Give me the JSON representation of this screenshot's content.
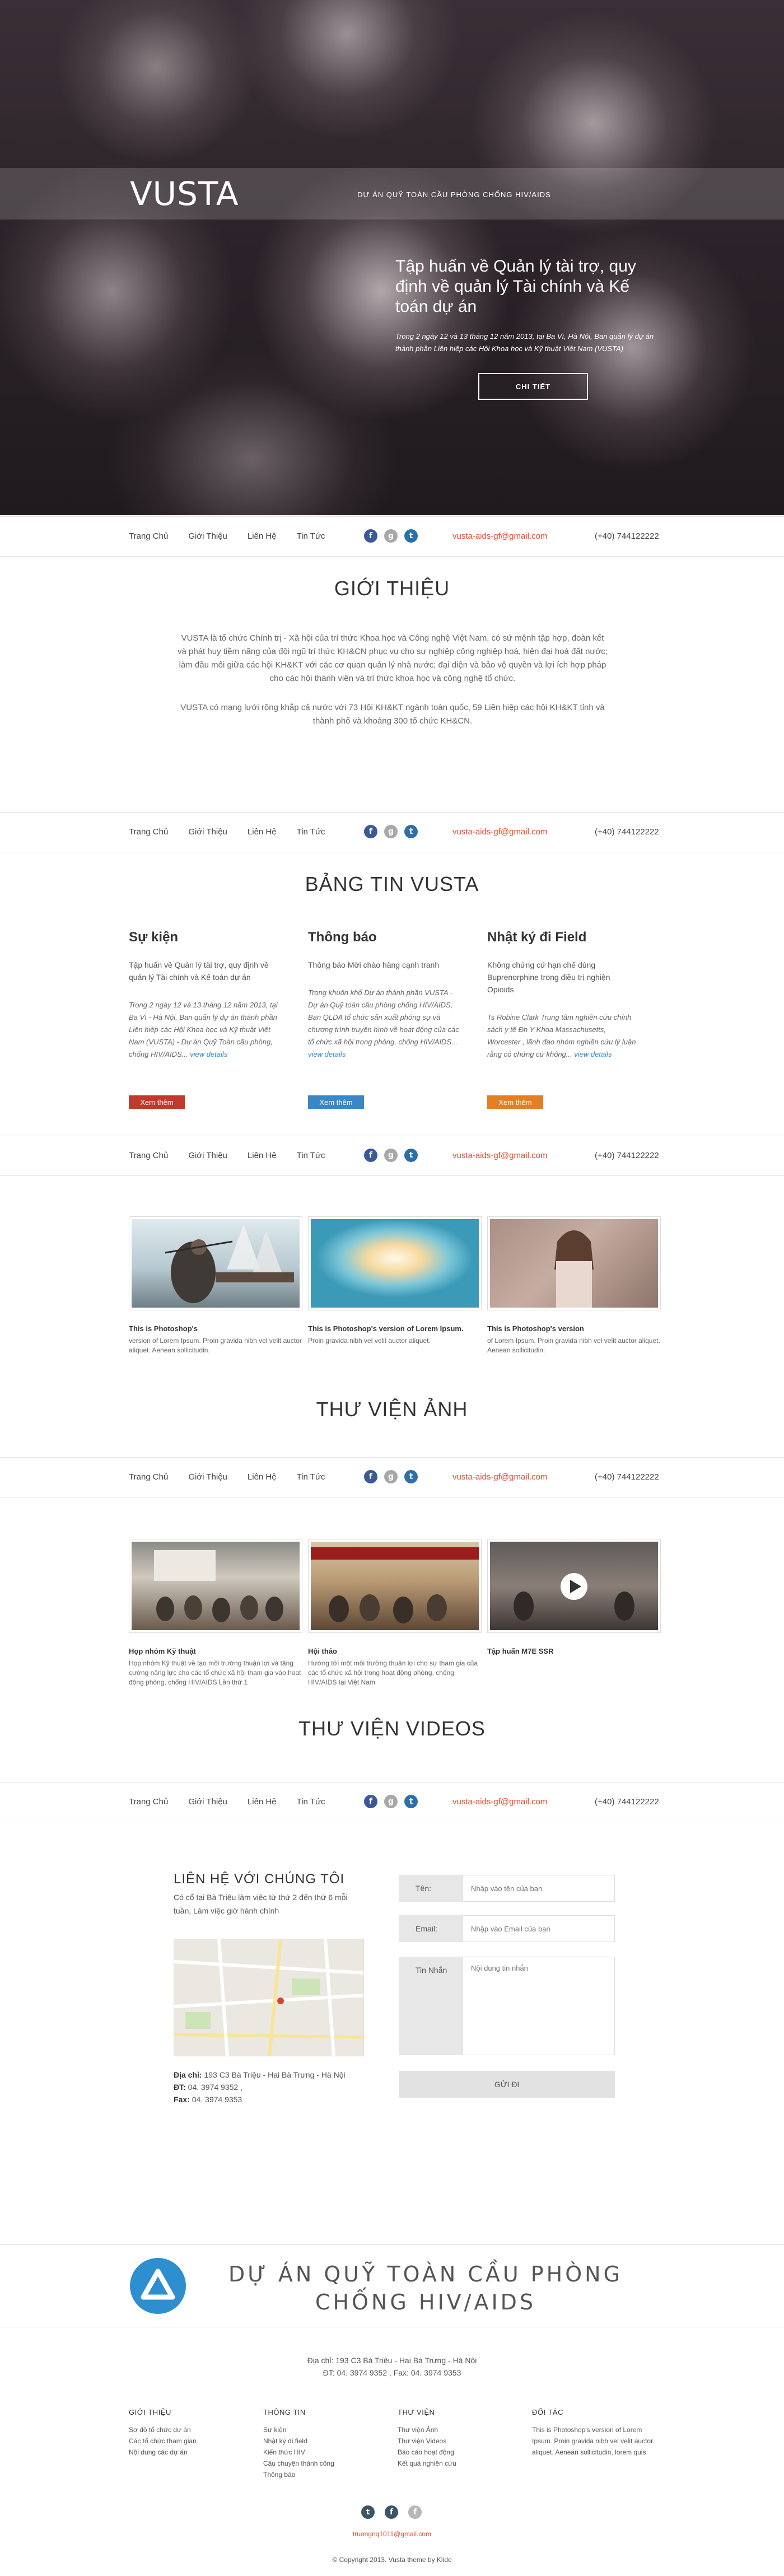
{
  "hero": {
    "logo": "VUSTA",
    "tagline": "DỰ ÁN QUỸ TOÀN CẦU PHÒNG CHỐNG HIV/AIDS",
    "heading": "Tập huấn về Quản lý tài trợ, quy định về quản lý Tài chính và Kế toán dự án",
    "subtitle": "Trong 2 ngày 12 và 13 tháng 12 năm 2013, tại Ba Vì, Hà Nội, Ban quản lý dự án thành phần Liên hiệp các Hội Khoa học và Kỹ thuật Việt Nam (VUSTA)",
    "button": "CHI TIẾT"
  },
  "nav": {
    "items": [
      "Trang Chủ",
      "Giới Thiệu",
      "Liên Hệ",
      "Tin Tức"
    ],
    "email": "vusta-aids-gf@gmail.com",
    "phone": "(+40) 744122222",
    "social": {
      "facebook": "f",
      "googleplus": "g",
      "twitter": "t"
    }
  },
  "intro": {
    "title": "GIỚI THIỆU",
    "p1": "VUSTA là tổ chức Chính trị - Xã hội của trí thức Khoa học và Công nghệ Việt Nam, có sứ mệnh tập hợp, đoàn kết và phát huy tiềm năng của đội ngũ trí thức KH&CN phục vụ cho sự nghiệp công nghiệp hoá, hiện đại hoá đất nước; làm đầu mối giữa các hội KH&KT với các cơ quan quản lý nhà nước; đại diện và bảo vệ quyền và lợi ích hợp pháp cho các hội thành viên và trí thức khoa học và công nghệ tổ chức.",
    "p2": "VUSTA có mạng lưới rộng khắp cả nước với 73 Hội KH&KT ngành toàn quốc, 59 Liên hiệp các hội KH&KT tỉnh và thành phố và khoảng 300 tổ chức KH&CN."
  },
  "news": {
    "title": "BẢNG TIN VUSTA",
    "columns": [
      {
        "heading": "Sự kiện",
        "lead": "Tập huấn về Quản lý tài trợ, quy định về quản lý Tài chính và Kế toán dự án",
        "body": "Trong 2 ngày 12 và 13 tháng 12 năm 2013, tại Ba Vì - Hà Nội, Ban quản lý dự án thành phần Liên hiệp các Hội Khoa học và Kỹ thuật Việt Nam (VUSTA) - Dự án Quỹ Toàn cầu phòng, chống HIV/AIDS...",
        "more": "view details",
        "button": "Xem thêm",
        "color": "#c0392b"
      },
      {
        "heading": "Thông báo",
        "lead": "Thông báo Mời chào hàng cạnh tranh",
        "body": "Trong khuôn khổ Dự án thành phần VUSTA - Dự án Quỹ toàn cầu phòng chống HIV/AIDS, Ban QLDA tổ chức sản xuất phóng sự và chương trình truyền hình về hoạt động của các tổ chức xã hội trong phòng, chống HIV/AIDS...",
        "more": "view details",
        "button": "Xem thêm",
        "color": "#3a87c8"
      },
      {
        "heading": "Nhật ký đi Field",
        "lead": "Không chứng cứ hạn chế dùng Buprenorphine trong điều trị nghiện Opioids",
        "body": "Ts Robine Clark Trung tâm nghiên cứu chính sách y tế Đh Y Khoa Massachusetts, Worcester , lãnh đạo nhóm nghiên cứu lý luận rằng có chứng cứ không...",
        "more": "view details",
        "button": "Xem thêm",
        "color": "#e67e22"
      }
    ]
  },
  "photos": {
    "title": "THƯ VIỆN ẢNH",
    "items": [
      {
        "title": "This is Photoshop's",
        "desc": "version of Lorem Ipsum. Proin gravida nibh vel velit auctor aliquet. Aenean sollicitudin."
      },
      {
        "title": "This is Photoshop's version of Lorem Ipsum.",
        "desc": "Proin gravida nibh vel velit auctor aliquet."
      },
      {
        "title": "This is Photoshop's version",
        "desc": "of Lorem Ipsum. Proin gravida nibh vel velit auctor aliquet. Aenean sollicitudin."
      }
    ]
  },
  "videos": {
    "title": "THƯ VIỆN VIDEOS",
    "items": [
      {
        "title": "Họp nhóm Kỹ thuật",
        "desc": "Họp nhóm Kỹ thuật về tạo môi trường thuận lợi và tăng cường năng lực cho các tổ chức xã hội tham gia vào hoạt động phòng, chống HIV/AIDS Lần thứ 1"
      },
      {
        "title": "Hội thảo",
        "desc": "Hướng tới một môi trường thuận lợi cho sự tham gia của các tổ chức xã hội trong hoạt động phòng, chống HIV/AIDS tại Việt Nam"
      },
      {
        "title": "Tập huấn M7E SSR",
        "desc": ""
      }
    ]
  },
  "contact": {
    "title": "LIÊN HỆ VỚI CHÚNG TÔI",
    "desc": "Có cổ tại Bà Triệu làm việc từ thứ 2 đến thứ 6 mỗi tuần, Làm việc giờ hành chính",
    "address_label": "Địa chỉ:",
    "address": "193 C3 Bà Triệu - Hai Bà Trưng - Hà Nội",
    "phone_label": "ĐT:",
    "phone": "04. 3974 9352 ,",
    "fax_label": "Fax:",
    "fax": "04. 3974 9353",
    "form": {
      "name_label": "Tên:",
      "name_placeholder": "Nhập vào tên của bạn",
      "email_label": "Email:",
      "email_placeholder": "Nhập vào Email của bạn",
      "message_label": "Tin Nhắn",
      "message_placeholder": "Nội dung tin nhắn",
      "send": "GỬI ĐI"
    }
  },
  "footer": {
    "project": "DỰ ÁN QUỸ TOÀN CẦU PHÒNG CHỐNG HIV/AIDS",
    "address": "Địa chỉ: 193 C3 Bà Triệu - Hai Bà Trưng - Hà Nội",
    "phones": "ĐT: 04. 3974 9352 , Fax: 04. 3974 9353",
    "columns": [
      {
        "heading": "GIỚI THIỆU",
        "items": [
          "Sơ đồ tổ chức dự án",
          "Các tổ chức tham gian",
          "Nội dung các dự án"
        ]
      },
      {
        "heading": "THÔNG TIN",
        "items": [
          "Sự kiện",
          "Nhật ký đi field",
          "Kiến thức HIV",
          "Câu chuyện thành công",
          "Thông báo"
        ]
      },
      {
        "heading": "THƯ VIỆN",
        "items": [
          "Thư viện Ảnh",
          "Thư viện Videos",
          "Báo cáo hoạt động",
          "Kết quả nghiên cứu"
        ]
      },
      {
        "heading": "ĐỐI TÁC",
        "items": [
          "This is Photoshop's version of Lorem Ipsum. Proin gravida nibh vel velit auctor aliquet. Aenean sollicitudin, lorem quis"
        ]
      }
    ],
    "email": "truongnq1011@gmail.com",
    "copyright": "© Copyright 2013. Vusta theme by Klide"
  }
}
